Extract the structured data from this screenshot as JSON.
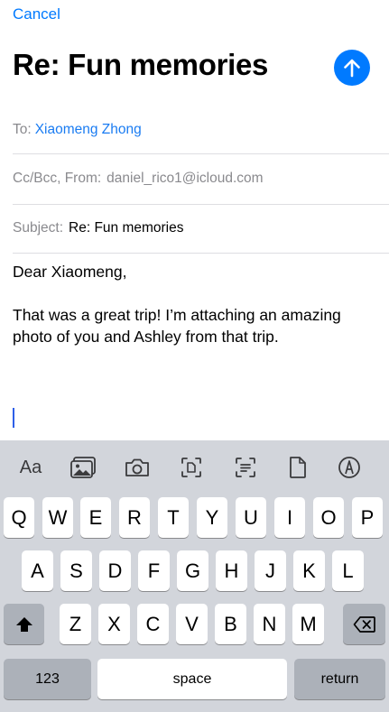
{
  "header": {
    "cancel_label": "Cancel",
    "title": "Re: Fun memories"
  },
  "fields": {
    "to_label": "To:",
    "to_value": "Xiaomeng Zhong",
    "ccbcc_label": "Cc/Bcc, From:",
    "from_value": "daniel_rico1@icloud.com",
    "subject_label": "Subject:",
    "subject_value": "Re: Fun memories"
  },
  "body": {
    "greeting": "Dear Xiaomeng,",
    "paragraph": "That was a great trip! I’m attaching an amazing photo of you and Ashley from that trip."
  },
  "toolbar": {
    "format_label": "Aa",
    "icons": [
      "photo-library-icon",
      "camera-icon",
      "scan-document-icon",
      "scan-text-icon",
      "document-icon",
      "markup-icon"
    ]
  },
  "keyboard": {
    "row1": [
      "Q",
      "W",
      "E",
      "R",
      "T",
      "Y",
      "U",
      "I",
      "O",
      "P"
    ],
    "row2": [
      "A",
      "S",
      "D",
      "F",
      "G",
      "H",
      "J",
      "K",
      "L"
    ],
    "row3": [
      "Z",
      "X",
      "C",
      "V",
      "B",
      "N",
      "M"
    ],
    "numbers_label": "123",
    "space_label": "space",
    "return_label": "return"
  },
  "colors": {
    "accent": "#007aff",
    "keyboard_bg": "#d2d5db",
    "key_bg": "#ffffff",
    "dark_key_bg": "#acb1b9"
  }
}
